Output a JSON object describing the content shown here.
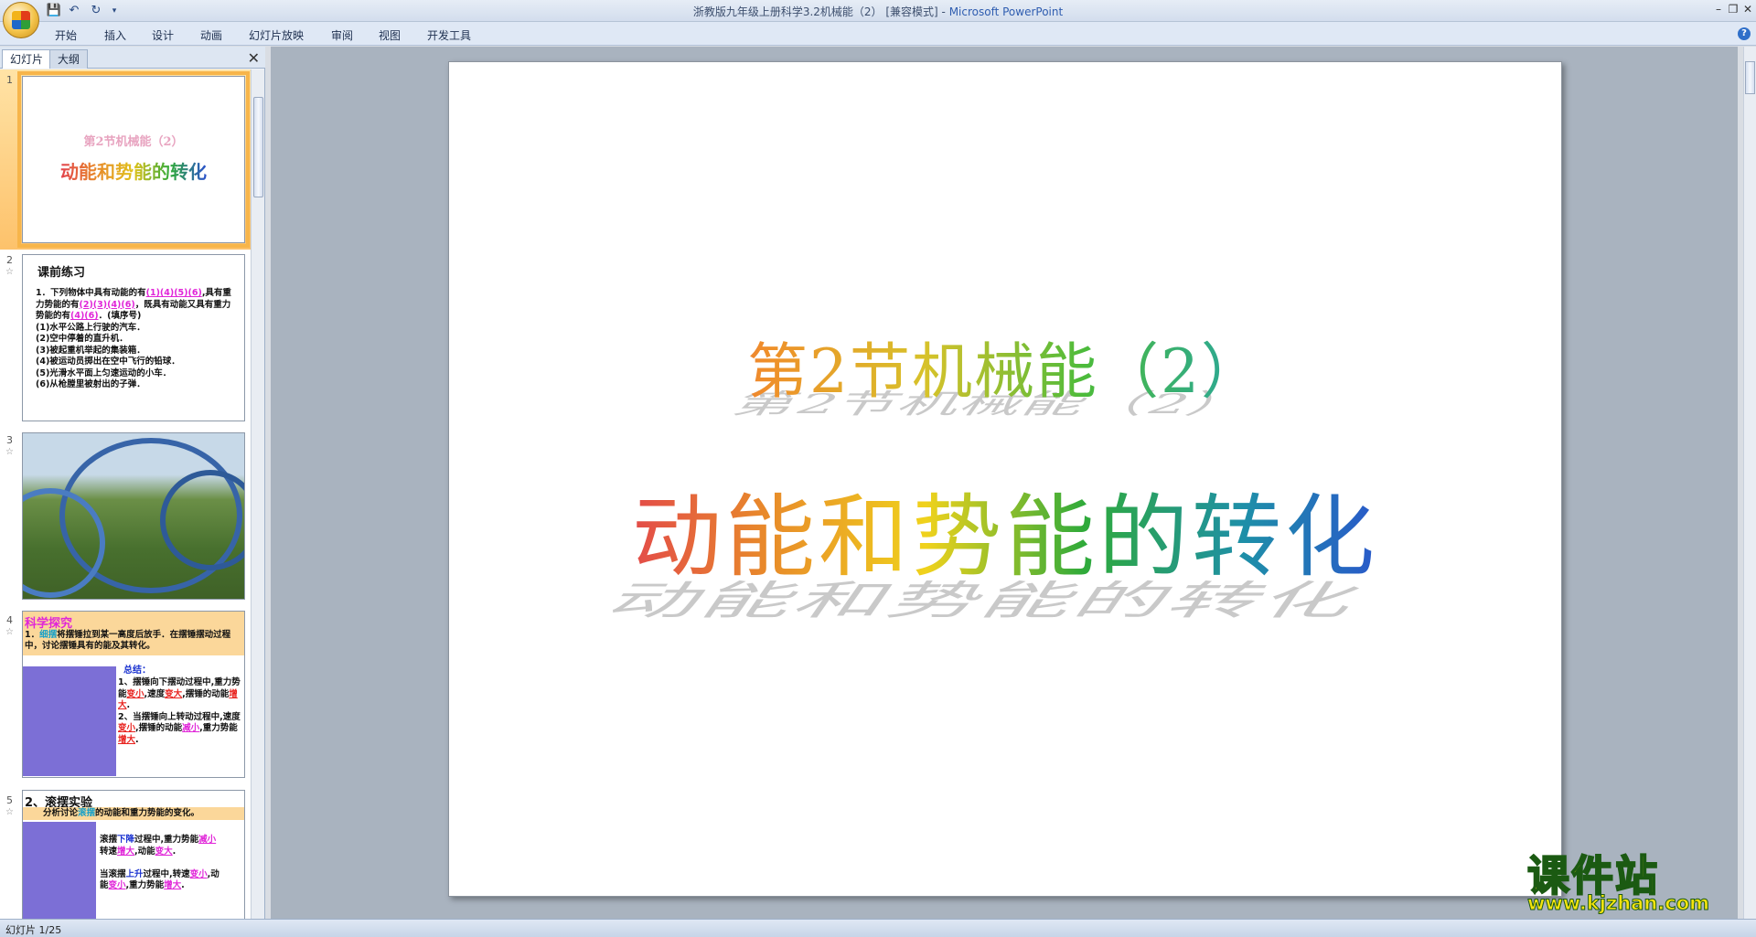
{
  "window": {
    "title": "浙教版九年级上册科学3.2机械能（2）  [兼容模式]",
    "app_name": "Microsoft PowerPoint",
    "app_separator": " - "
  },
  "quick_access": {
    "save_icon": "save-icon",
    "undo_icon": "undo-icon",
    "redo_icon": "redo-icon",
    "customize_icon": "dropdown-icon"
  },
  "ribbon": {
    "tabs": [
      "开始",
      "插入",
      "设计",
      "动画",
      "幻灯片放映",
      "审阅",
      "视图",
      "开发工具"
    ],
    "help_label": "?"
  },
  "left_pane": {
    "tabs": [
      "幻灯片",
      "大纲"
    ],
    "close_label": "✕"
  },
  "thumbnails": [
    {
      "num": "1",
      "subtitle": "第2节机械能（2）",
      "title": "动能和势能的转化"
    },
    {
      "num": "2",
      "heading": "课前练习",
      "q_prefix": "1．下列物体中具有动能的有",
      "ans1": "(1)(4)(5)(6)",
      "q_mid1": ",具有重力势能的有",
      "ans2": "(2)(3)(4)(6)",
      "q_mid2": "，既具有动能又具有重力势能的有",
      "ans3": "(4)(6)",
      "q_end": "．(填序号)",
      "items": [
        "(1)水平公路上行驶的汽车．",
        "(2)空中停着的直升机．",
        "(3)被起重机举起的集装箱．",
        "(4)被运动员掷出在空中飞行的铅球．",
        "(5)光滑水平面上匀速运动的小车．",
        "(6)从枪膛里被射出的子弹．"
      ]
    },
    {
      "num": "3"
    },
    {
      "num": "4",
      "title": "科学探究",
      "q_num": "1．",
      "q_hl": "细摆",
      "q_text": "将摆锤拉到某一高度后放手．在摆锤摆动过程中，讨论摆锤具有的能及其转化。",
      "sum_head": "总结：",
      "s1a": "1、摆锤向下摆动过程中,重力势能",
      "s1b": "变小",
      "s1c": ",速度",
      "s1d": "变大",
      "s1e": ",摆锤的动能",
      "s1f": "增大",
      "s2a": "2、当摆锤向上转动过程中,速度",
      "s2b": "变小",
      "s2c": ",摆锤的动能",
      "s2d": "减小",
      "s2e": ",重力势能",
      "s2f": "增大"
    },
    {
      "num": "5",
      "title": "2、滚摆实验",
      "q_a": "分析讨论",
      "q_hl": "滚摆",
      "q_b": "的动能和重力势能的变化。",
      "l1a": "滚摆",
      "l1b": "下降",
      "l1c": "过程中,重力势能",
      "l1d": "减小",
      "l2a": "转速",
      "l2b": "增大",
      "l2c": ",动能",
      "l2d": "变大",
      "l3a": "当滚摆",
      "l3b": "上升",
      "l3c": "过程中,转速",
      "l3d": "变小",
      "l3e": ",动",
      "l4a": "能",
      "l4b": "变小",
      "l4c": ",重力势能",
      "l4d": "增大"
    }
  ],
  "slide": {
    "title_line1": "第2节机械能（2）",
    "title_line2": "动能和势能的转化"
  },
  "status": {
    "slide_indicator": "幻灯片 1/25"
  },
  "watermark": {
    "main": "课件站",
    "url": "www.kjzhan.com"
  },
  "colors": {
    "accent": "#2f5db0",
    "selection": "#f7b54a",
    "watermark": "#f6e40f"
  }
}
